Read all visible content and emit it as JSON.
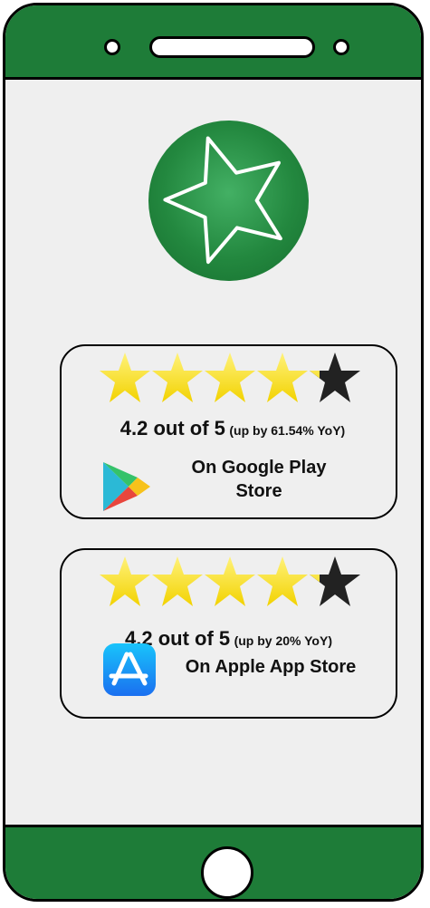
{
  "cards": [
    {
      "rating_main": "4.2 out of 5",
      "rating_change": "(up by 61.54% YoY)",
      "store_label": "On Google Play Store",
      "store_icon": "google-play-icon",
      "stars_filled": 4.2,
      "stars_total": 5
    },
    {
      "rating_main": "4.2 out of 5",
      "rating_change": "(up by 20% YoY)",
      "store_label": "On Apple App Store",
      "store_icon": "apple-app-store-icon",
      "stars_filled": 4.2,
      "stars_total": 5
    }
  ],
  "colors": {
    "phone_green": "#1e7c38",
    "screen_gray": "#efefef",
    "star_gold": "#f5e000",
    "star_dark": "#222222",
    "app_store_blue": "#1a7ef5"
  },
  "icons": {
    "badge": "star-outline-icon",
    "camera": "camera-dot",
    "speaker": "speaker-slot",
    "home": "home-button"
  }
}
